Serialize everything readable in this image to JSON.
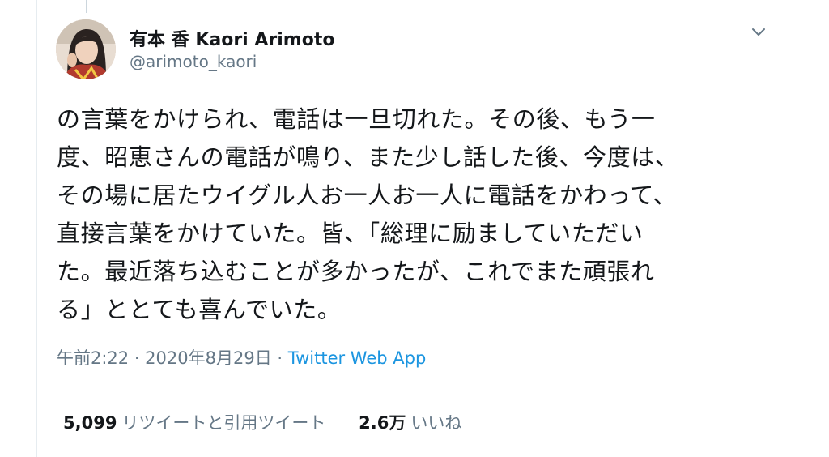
{
  "author": {
    "display_name": "有本 香 Kaori Arimoto",
    "handle": "@arimoto_kaori"
  },
  "tweet": {
    "lines": [
      "の言葉をかけられ、電話は一旦切れた。その後、もう一",
      "度、昭恵さんの電話が鳴り、また少し話した後、今度は、",
      "その場に居たウイグル人お一人お一人に電話をかわって、",
      "直接言葉をかけていた。皆、「総理に励ましていただい",
      "た。最近落ち込むことが多かったが、これでまた頑張れ",
      "る」ととても喜んでいた。"
    ],
    "timestamp": "午前2:22 · 2020年8月29日 · ",
    "source": "Twitter Web App"
  },
  "stats": {
    "retweets_count": "5,099",
    "retweets_label": "リツイートと引用ツイート",
    "likes_count": "2.6万",
    "likes_label": "いいね"
  },
  "icons": {
    "menu": "chevron-down-icon",
    "avatar": "user-avatar-photo"
  },
  "colors": {
    "text": "#14171a",
    "secondary": "#657786",
    "link": "#1b95e0",
    "border": "#e6ecf0"
  }
}
